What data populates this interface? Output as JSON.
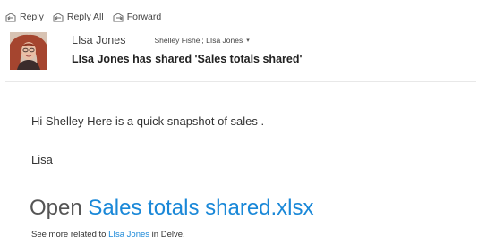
{
  "toolbar": {
    "reply_label": "Reply",
    "reply_all_label": "Reply All",
    "forward_label": "Forward"
  },
  "message": {
    "sender_name": "LIsa Jones",
    "recipients": "Shelley Fishel; LIsa Jones",
    "subject": "LIsa Jones has shared 'Sales totals shared'",
    "greeting_line": "Hi Shelley Here is a quick snapshot of sales .",
    "signature": "Lisa",
    "open_prefix": "Open ",
    "file_link": "Sales totals shared.xlsx",
    "related_prefix": "See more related to ",
    "related_person": "LIsa Jones",
    "related_suffix": " in Delve."
  },
  "colors": {
    "link": "#1a88d8",
    "text": "#333333"
  }
}
